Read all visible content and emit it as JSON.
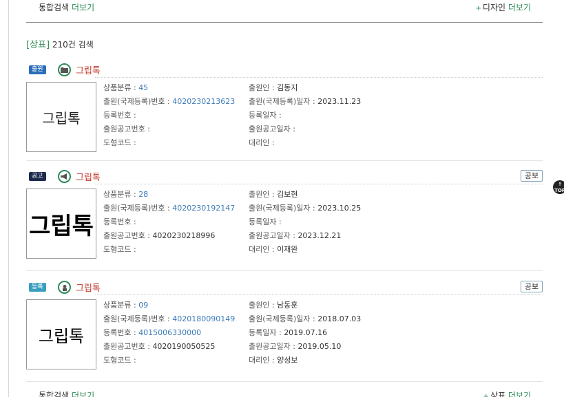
{
  "top": {
    "left_label": "통합검색",
    "left_more": "더보기",
    "right_plus": "+",
    "right_label": "디자인",
    "right_more": "더보기"
  },
  "summary": {
    "category": "[상표]",
    "count": "210건 검색"
  },
  "labels": {
    "class": "상품분류 :",
    "app_no": "출원(국제등록)번호 :",
    "reg_no": "등록번호 :",
    "pub_no": "출원공고번호 :",
    "fig": "도형코드 :",
    "applicant": "출원인 :",
    "app_date": "출원(국제등록)일자 :",
    "reg_date": "등록일자 :",
    "pub_date": "출원공고일자 :",
    "agent": "대리인 :"
  },
  "results": [
    {
      "status": "출원",
      "status_color": "#2a6ebb",
      "icon": "folder-icon",
      "name": "그립톡",
      "thumb_text": "그립톡",
      "gongbo": "",
      "class_val": "45",
      "app_no": "4020230213623",
      "reg_no": "",
      "pub_no": "",
      "fig": "",
      "applicant": "김동지",
      "app_date": "2023.11.23",
      "reg_date": "",
      "pub_date": "",
      "agent": ""
    },
    {
      "status": "공고",
      "status_color": "#1c2a4e",
      "icon": "megaphone-icon",
      "name": "그립톡",
      "thumb_text": "그립톡",
      "gongbo": "공보",
      "class_val": "28",
      "app_no": "4020230192147",
      "reg_no": "",
      "pub_no": "4020230218996",
      "fig": "",
      "applicant": "김보현",
      "app_date": "2023.10.25",
      "reg_date": "",
      "pub_date": "2023.12.21",
      "agent": "이재완"
    },
    {
      "status": "등록",
      "status_color": "#3a9fbf",
      "icon": "registered-icon",
      "name": "그립톡",
      "thumb_text": "그립톡",
      "gongbo": "공보",
      "class_val": "09",
      "app_no": "4020180090149",
      "reg_no": "4015006330000",
      "pub_no": "4020190050525",
      "fig": "",
      "applicant": "남동훈",
      "app_date": "2018.07.03",
      "reg_date": "2019.07.16",
      "pub_date": "2019.05.10",
      "agent": "양성보"
    }
  ],
  "bottom": {
    "left_label": "통합검색",
    "left_more": "더보기",
    "right_plus": "+",
    "right_label": "상표",
    "right_more": "더보기"
  },
  "top_button": "TOP"
}
